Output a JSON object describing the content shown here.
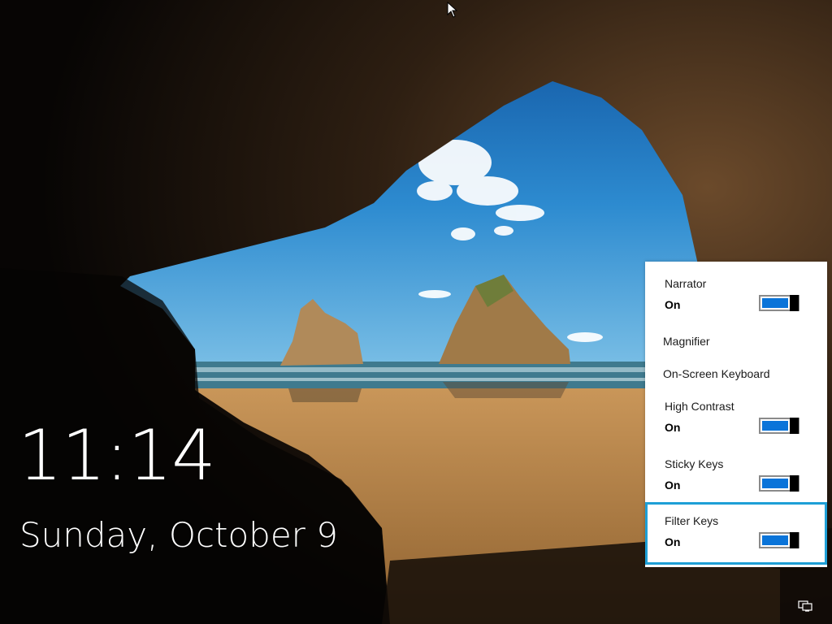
{
  "lock_screen": {
    "time": "11:14",
    "date": "Sunday, October 9",
    "background": "cave-arch-beach-wallpaper"
  },
  "ease_of_access": {
    "items": [
      {
        "label": "Narrator",
        "state": "On",
        "has_toggle": true
      },
      {
        "label": "Magnifier",
        "state": "",
        "has_toggle": false
      },
      {
        "label": "On-Screen Keyboard",
        "state": "",
        "has_toggle": false
      },
      {
        "label": "High Contrast",
        "state": "On",
        "has_toggle": true
      },
      {
        "label": "Sticky Keys",
        "state": "On",
        "has_toggle": true
      },
      {
        "label": "Filter Keys",
        "state": "On",
        "has_toggle": true
      }
    ],
    "focused_item": "Filter Keys",
    "toggle_color": "#0a74d9",
    "focus_color": "#1e9fd6"
  },
  "system_tray": {
    "icon": "network-icon"
  },
  "cursor": {
    "icon": "mouse-pointer-icon"
  }
}
